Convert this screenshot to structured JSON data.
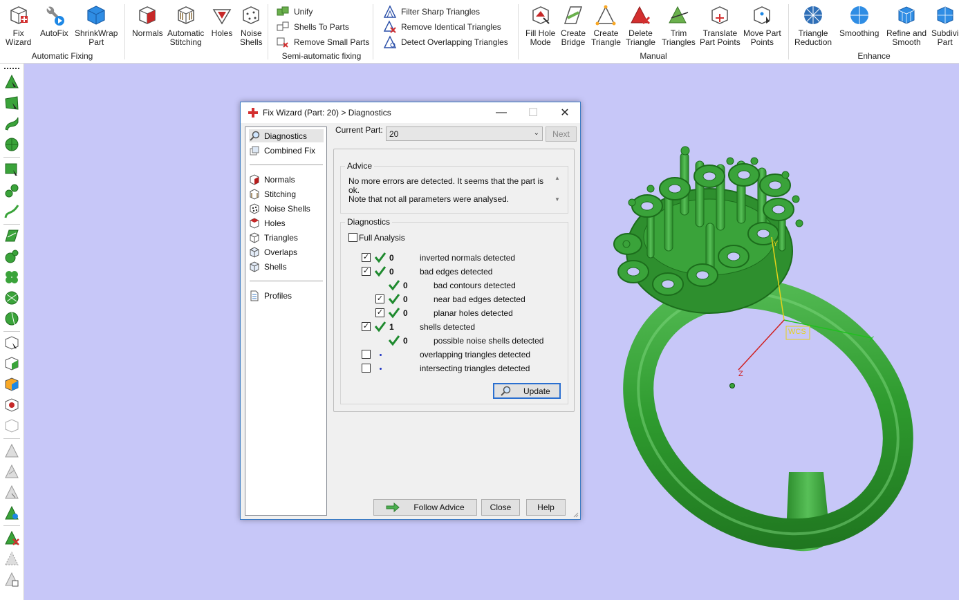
{
  "ribbon": {
    "groups": {
      "automatic_fixing": "Automatic Fixing",
      "semi_automatic": "Semi-automatic fixing",
      "manual": "Manual",
      "enhance": "Enhance"
    },
    "buttons": {
      "fix_wizard": [
        "Fix",
        "Wizard"
      ],
      "autofix": "AutoFix",
      "shrinkwrap": [
        "ShrinkWrap",
        "Part"
      ],
      "normals": "Normals",
      "auto_stitching": [
        "Automatic",
        "Stitching"
      ],
      "holes": "Holes",
      "noise_shells": [
        "Noise",
        "Shells"
      ],
      "unify": "Unify",
      "shells_to_parts": "Shells To Parts",
      "remove_small_parts": "Remove Small Parts",
      "filter_sharp": "Filter Sharp Triangles",
      "remove_identical": "Remove Identical Triangles",
      "detect_overlapping": "Detect Overlapping Triangles",
      "fill_hole_mode": [
        "Fill Hole",
        "Mode"
      ],
      "create_bridge": [
        "Create",
        "Bridge"
      ],
      "create_triangle": [
        "Create",
        "Triangle"
      ],
      "delete_triangle": [
        "Delete",
        "Triangle"
      ],
      "trim_triangles": [
        "Trim",
        "Triangles"
      ],
      "translate_points": [
        "Translate",
        "Part Points"
      ],
      "move_points": [
        "Move Part",
        "Points"
      ],
      "triangle_reduction": [
        "Triangle",
        "Reduction"
      ],
      "smoothing": "Smoothing",
      "refine_smooth": [
        "Refine and",
        "Smooth"
      ],
      "subdivide": [
        "Subdivi",
        "Part"
      ]
    }
  },
  "viewport": {
    "axis_y": "Y",
    "axis_x": "X",
    "axis_z": "Z",
    "wcs": "WCS"
  },
  "dialog": {
    "title": "Fix Wizard (Part: 20) > Diagnostics",
    "nav": {
      "diagnostics": "Diagnostics",
      "combined_fix": "Combined Fix",
      "normals": "Normals",
      "stitching": "Stitching",
      "noise_shells": "Noise Shells",
      "holes": "Holes",
      "triangles": "Triangles",
      "overlaps": "Overlaps",
      "shells": "Shells",
      "profiles": "Profiles"
    },
    "current_part_label": "Current Part:",
    "current_part_value": "20",
    "next_label": "Next",
    "advice_legend": "Advice",
    "advice_line1": "No more errors are detected. It seems that the part is ok.",
    "advice_line2": "Note that not all parameters were analysed.",
    "diagnostics_legend": "Diagnostics",
    "full_analysis": "Full Analysis",
    "rows": [
      {
        "label": "inverted normals detected",
        "count": "0",
        "checked": true
      },
      {
        "label": "bad edges detected",
        "count": "0",
        "checked": true
      },
      {
        "label": "bad contours detected",
        "count": "0"
      },
      {
        "label": "near bad edges detected",
        "count": "0",
        "checked": true
      },
      {
        "label": "planar holes detected",
        "count": "0",
        "checked": true
      },
      {
        "label": "shells detected",
        "count": "1",
        "checked": true
      },
      {
        "label": "possible noise shells detected",
        "count": "0"
      },
      {
        "label": "overlapping triangles detected",
        "checked": false
      },
      {
        "label": "intersecting triangles detected",
        "checked": false
      }
    ],
    "update_label": "Update",
    "follow_advice": "Follow Advice",
    "close": "Close",
    "help": "Help"
  },
  "colors": {
    "model_green": "#3aa33a",
    "viewport_bg": "#c7c7f8",
    "check_green": "#1e8a2e"
  }
}
